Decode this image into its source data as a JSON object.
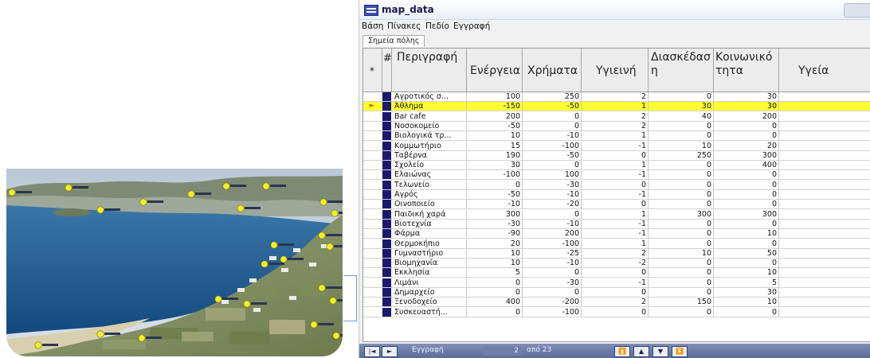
{
  "window": {
    "title": "map_data",
    "menu": [
      "Βάση",
      "Πίνακες",
      "Πεδίο",
      "Εγγραφή"
    ],
    "tab": "Σημεία πόλης",
    "header_marker": "*"
  },
  "grid": {
    "columns": {
      "id": "#",
      "desc": "Περιγραφή",
      "energy": "Ενέργεια",
      "money": "Χρήματα",
      "hygiene": "Υγιεινή",
      "fun": "Διασκέδαση",
      "social": "Κοινωνικότητα",
      "health": "Υγεία"
    },
    "rows": [
      {
        "desc": "Αγροτικός σ...",
        "energy": "100",
        "money": "250",
        "hygiene": "2",
        "fun": "0",
        "social": "30"
      },
      {
        "desc": "Άθλημα",
        "energy": "-150",
        "money": "-50",
        "hygiene": "1",
        "fun": "30",
        "social": "30",
        "selected": true,
        "marker": "►"
      },
      {
        "desc": "Bar cafe",
        "energy": "200",
        "money": "0",
        "hygiene": "2",
        "fun": "40",
        "social": "200"
      },
      {
        "desc": "Νοσοκομείο",
        "energy": "-50",
        "money": "0",
        "hygiene": "2",
        "fun": "0",
        "social": "0"
      },
      {
        "desc": "Βιολογικά τρ...",
        "energy": "10",
        "money": "-10",
        "hygiene": "1",
        "fun": "0",
        "social": "0"
      },
      {
        "desc": "Κομμωτήριο",
        "energy": "15",
        "money": "-100",
        "hygiene": "-1",
        "fun": "10",
        "social": "20"
      },
      {
        "desc": "Ταβέρνα",
        "energy": "190",
        "money": "-50",
        "hygiene": "0",
        "fun": "250",
        "social": "300"
      },
      {
        "desc": "Σχολείο",
        "energy": "30",
        "money": "0",
        "hygiene": "1",
        "fun": "0",
        "social": "400"
      },
      {
        "desc": "Ελαιώνας",
        "energy": "-100",
        "money": "100",
        "hygiene": "-1",
        "fun": "0",
        "social": "0"
      },
      {
        "desc": "Τελωνείο",
        "energy": "0",
        "money": "-30",
        "hygiene": "0",
        "fun": "0",
        "social": "0"
      },
      {
        "desc": "Αγρός",
        "energy": "-50",
        "money": "-10",
        "hygiene": "-1",
        "fun": "0",
        "social": "0"
      },
      {
        "desc": "Οινοποιείο",
        "energy": "-10",
        "money": "-20",
        "hygiene": "0",
        "fun": "0",
        "social": "0"
      },
      {
        "desc": "Παιδική χαρά",
        "energy": "300",
        "money": "0",
        "hygiene": "1",
        "fun": "300",
        "social": "300"
      },
      {
        "desc": "Βιοτεχνία",
        "energy": "-30",
        "money": "-10",
        "hygiene": "-1",
        "fun": "0",
        "social": "0"
      },
      {
        "desc": "Φάρμα",
        "energy": "-90",
        "money": "200",
        "hygiene": "-1",
        "fun": "0",
        "social": "10"
      },
      {
        "desc": "Θερμοκήπιο",
        "energy": "20",
        "money": "-100",
        "hygiene": "1",
        "fun": "0",
        "social": "0"
      },
      {
        "desc": "Γυμναστήριο",
        "energy": "10",
        "money": "-25",
        "hygiene": "2",
        "fun": "10",
        "social": "50"
      },
      {
        "desc": "Βιομηχανία",
        "energy": "10",
        "money": "-10",
        "hygiene": "-2",
        "fun": "0",
        "social": "0"
      },
      {
        "desc": "Εκκλησία",
        "energy": "5",
        "money": "0",
        "hygiene": "0",
        "fun": "0",
        "social": "10"
      },
      {
        "desc": "Λιμάνι",
        "energy": "0",
        "money": "-30",
        "hygiene": "-1",
        "fun": "0",
        "social": "5"
      },
      {
        "desc": "Δημαρχείο",
        "energy": "0",
        "money": "0",
        "hygiene": "0",
        "fun": "0",
        "social": "30"
      },
      {
        "desc": "Ξενοδοχείο",
        "energy": "400",
        "money": "-200",
        "hygiene": "2",
        "fun": "150",
        "social": "10"
      },
      {
        "desc": "Συσκευαστή...",
        "energy": "0",
        "money": "-100",
        "hygiene": "0",
        "fun": "0",
        "social": "0"
      }
    ]
  },
  "navigator": {
    "label": "Εγγραφή",
    "current": "2",
    "of_text": "από 23"
  },
  "photo": {
    "pins": 24,
    "colors": {
      "sky": "#c7d3de",
      "sea": "#1f5c92",
      "hills": "#8c9a78",
      "pin": "#f2ee25"
    }
  }
}
